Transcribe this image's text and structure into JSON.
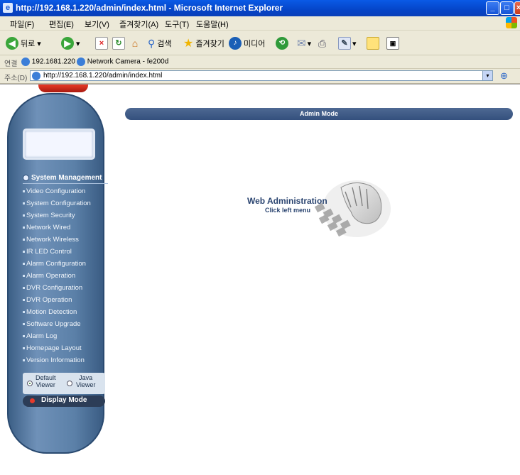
{
  "window": {
    "title": "http://192.168.1.220/admin/index.html - Microsoft Internet Explorer",
    "minimize_icon": "minimize-icon",
    "maximize_icon": "maximize-icon",
    "close_icon": "close-icon"
  },
  "menubar": {
    "items": [
      "파일(F)",
      "편집(E)",
      "보기(V)",
      "즐겨찾기(A)",
      "도구(T)",
      "도움말(H)"
    ]
  },
  "toolbar": {
    "back_label": "뒤로",
    "search_label": "검색",
    "favorites_label": "즐겨찾기",
    "media_label": "미디어"
  },
  "links_bar": {
    "label": "연결",
    "link1": "192.1681.220",
    "link2": "Network Camera - fe200d"
  },
  "address_bar": {
    "label": "주소(D)",
    "url": "http://192.168.1.220/admin/index.html"
  },
  "sidebar": {
    "menu_header": "System Management",
    "items": [
      "Video Configuration",
      "System Configuration",
      "System Security",
      "Network Wired",
      "Network Wireless",
      "IR LED Control",
      "Alarm Configuration",
      "Alarm Operation",
      "DVR Configuration",
      "DVR Operation",
      "Motion Detection",
      "Software Upgrade",
      "Alarm Log",
      "Homepage Layout",
      "Version Information"
    ],
    "viewer_default_1": "Default",
    "viewer_default_2": "Viewer",
    "viewer_java_1": "Java",
    "viewer_java_2": "Viewer",
    "selected_viewer": "Default Viewer",
    "display_mode_label": "Display Mode"
  },
  "main": {
    "banner": "Admin Mode",
    "title": "Web Administration",
    "subtitle": "Click left menu"
  },
  "colors": {
    "titlebar": "#0545c8",
    "banner": "#3f5a86",
    "sidebar": "#5b80a8",
    "text_accent": "#2a4470"
  }
}
